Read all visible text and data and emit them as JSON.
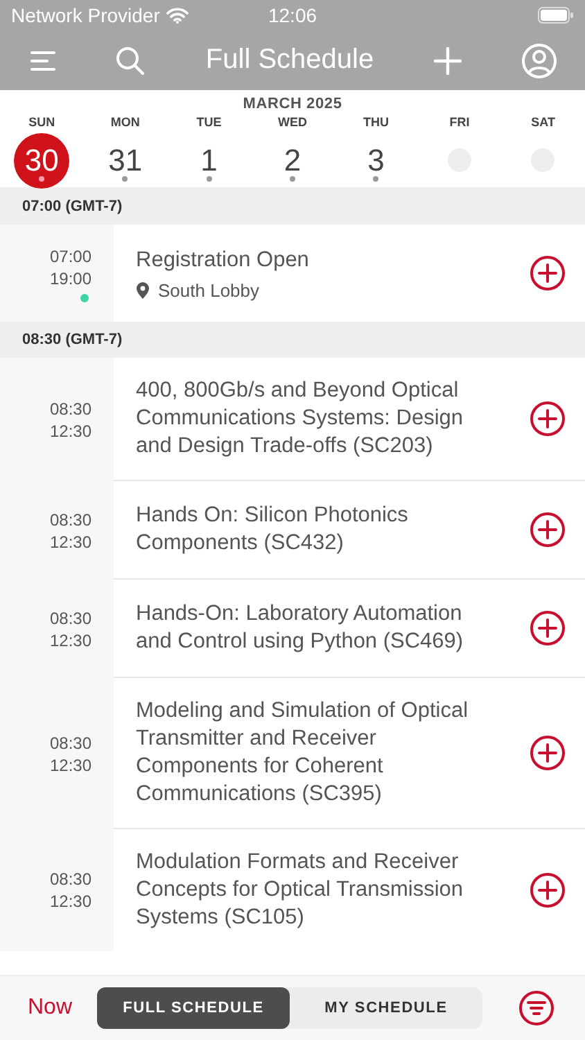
{
  "status_bar": {
    "carrier": "Network Provider",
    "time": "12:06"
  },
  "nav": {
    "title": "Full Schedule"
  },
  "calendar": {
    "month": "MARCH 2025",
    "days": [
      {
        "label": "SUN",
        "number": "30",
        "selected": true,
        "has_events": true
      },
      {
        "label": "MON",
        "number": "31",
        "selected": false,
        "has_events": true
      },
      {
        "label": "TUE",
        "number": "1",
        "selected": false,
        "has_events": true
      },
      {
        "label": "WED",
        "number": "2",
        "selected": false,
        "has_events": true
      },
      {
        "label": "THU",
        "number": "3",
        "selected": false,
        "has_events": true
      },
      {
        "label": "FRI",
        "selected": false,
        "has_events": false
      },
      {
        "label": "SAT",
        "selected": false,
        "has_events": false
      }
    ]
  },
  "groups": [
    {
      "header": "07:00 (GMT-7)",
      "sessions": [
        {
          "start": "07:00",
          "end": "19:00",
          "title": "Registration Open",
          "location": "South Lobby",
          "color": "#3fd3a8"
        }
      ]
    },
    {
      "header": "08:30 (GMT-7)",
      "sessions": [
        {
          "start": "08:30",
          "end": "12:30",
          "title": "400, 800Gb/s and Beyond Optical Communications Systems: Design and Design Trade-offs (SC203)"
        },
        {
          "start": "08:30",
          "end": "12:30",
          "title": "Hands On: Silicon Photonics Components (SC432)"
        },
        {
          "start": "08:30",
          "end": "12:30",
          "title": "Hands-On: Laboratory Automation and Control using Python (SC469)"
        },
        {
          "start": "08:30",
          "end": "12:30",
          "title": "Modeling and Simulation of Optical Transmitter and Receiver Components for Coherent Communications (SC395)"
        },
        {
          "start": "08:30",
          "end": "12:30",
          "title": "Modulation Formats and Receiver Concepts for Optical Transmission Systems (SC105)"
        }
      ]
    }
  ],
  "bottom_bar": {
    "now": "Now",
    "tabs": [
      {
        "label": "FULL SCHEDULE",
        "selected": true
      },
      {
        "label": "MY SCHEDULE",
        "selected": false
      }
    ]
  }
}
